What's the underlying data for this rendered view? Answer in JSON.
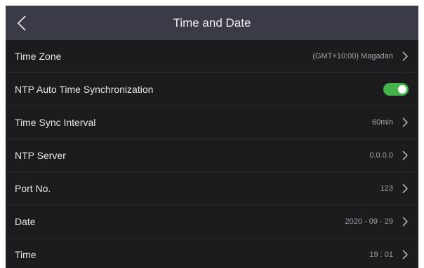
{
  "header": {
    "title": "Time and Date",
    "back_icon": "back-chevron-icon"
  },
  "rows": [
    {
      "label": "Time Zone",
      "value": "(GMT+10:00) Magadan"
    },
    {
      "label": "NTP Auto Time Synchronization",
      "toggle_on": true
    },
    {
      "label": "Time Sync Interval",
      "value": "60min"
    },
    {
      "label": "NTP Server",
      "value": "0.0.0.0"
    },
    {
      "label": "Port No.",
      "value": "123"
    },
    {
      "label": "Date",
      "value": "2020 - 09 - 29"
    },
    {
      "label": "Time",
      "value": "19 : 01"
    }
  ],
  "colors": {
    "background": "#1c1c1f",
    "header": "#3a3b46",
    "toggle_on": "#43b34a"
  }
}
